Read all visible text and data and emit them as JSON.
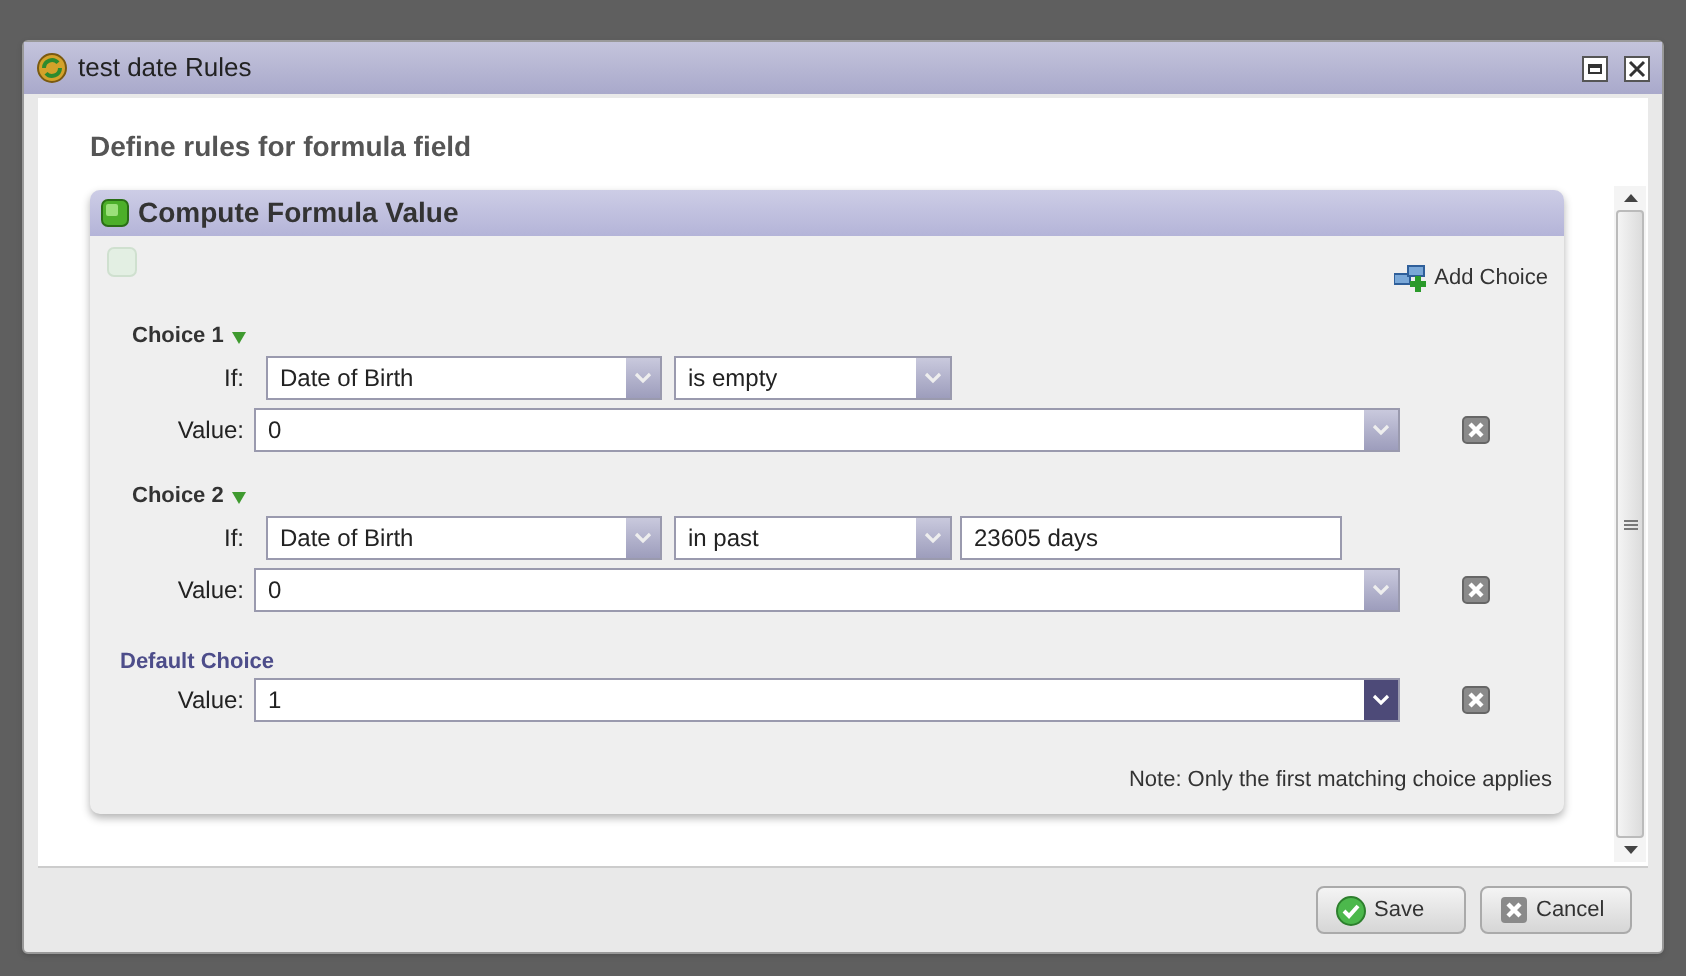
{
  "dialog": {
    "title": "test date Rules",
    "heading": "Define rules for formula field",
    "panel": {
      "title": "Compute Formula Value",
      "add_choice": "Add Choice",
      "choices": [
        {
          "title": "Choice 1",
          "if_label": "If:",
          "field": "Date of Birth",
          "operator": "is empty",
          "value_label": "Value:",
          "value": "0",
          "focused": false
        },
        {
          "title": "Choice 2",
          "if_label": "If:",
          "field": "Date of Birth",
          "operator": "in past",
          "operand": "23605 days",
          "value_label": "Value:",
          "value": "0",
          "focused": false
        }
      ],
      "default_choice": {
        "title": "Default Choice",
        "value_label": "Value:",
        "value": "1",
        "focused": true
      },
      "note": "Note: Only the first matching choice applies"
    },
    "buttons": [
      {
        "kind": "save",
        "label": "Save"
      },
      {
        "kind": "cancel",
        "label": "Cancel"
      }
    ]
  }
}
